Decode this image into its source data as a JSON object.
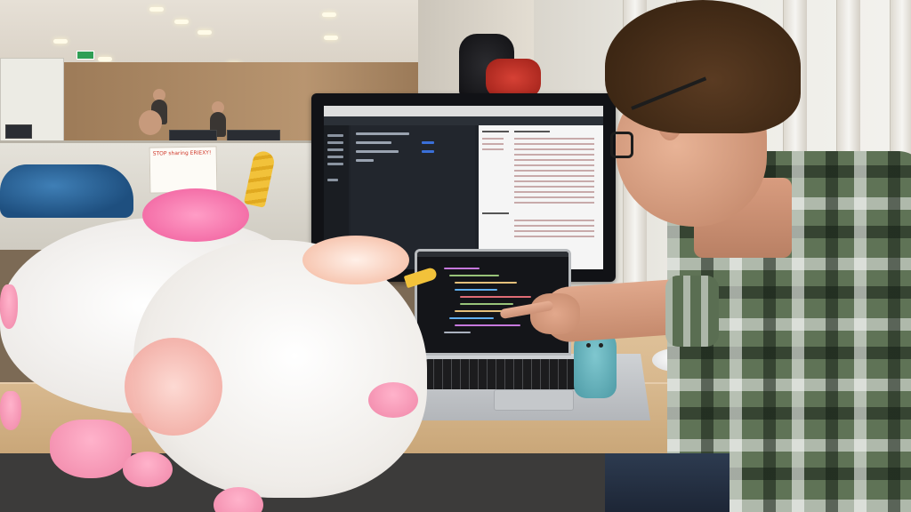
{
  "scene": {
    "note_card_text": "STOP sharing ERIEXY!"
  },
  "monitor": {
    "browser_bar_text": "",
    "app_header_text": ""
  },
  "colors": {
    "plaid_green": "#5f7356",
    "unicorn_pink": "#f46fa8",
    "horn_gold": "#f2c23a",
    "crochet_teal": "#6bb4bd"
  }
}
